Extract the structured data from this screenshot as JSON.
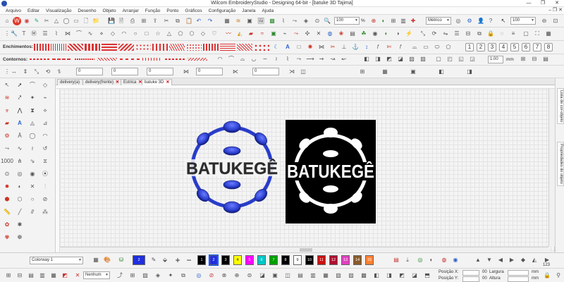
{
  "window": {
    "title": "Wilcom EmbroideryStudio - Designing 64-bit - [batuke 3D    Tajima]",
    "minimize": "—",
    "maximize": "❐",
    "close": "✕"
  },
  "menu": {
    "items": [
      "Arquivo",
      "Editar",
      "Visualização",
      "Desenho",
      "Objeto",
      "Arranjar",
      "Função",
      "Ponto",
      "Gráficos",
      "Configuração",
      "Janela",
      "Ajuda"
    ],
    "mdi_controls": "– ❐ ✕"
  },
  "toolbar": {
    "zoom_value": "100",
    "zoom_unit": "%",
    "units_value": "Métrico",
    "zoom_value_2": "100",
    "enchimentos_label": "Enchimentos:",
    "contornos_label": "Contornos:",
    "size_value": "1.00",
    "size_unit": "mm",
    "field_values": [
      "0",
      "0",
      "0",
      "0",
      "0"
    ]
  },
  "tabs": [
    {
      "label": "delivery(a)",
      "active": false
    },
    {
      "label": "delivery(frente)",
      "active": false
    },
    {
      "label": "Estrica",
      "active": false
    },
    {
      "label": "batuke 3D",
      "active": true
    }
  ],
  "side_panels": {
    "panel_1": "Lista de cor-objeto",
    "panel_2": "Propriedades do objeto"
  },
  "design": {
    "text": "BATUKEGÊ",
    "blue_color": "#2b3fcf",
    "black_color": "#000000"
  },
  "bottombar": {
    "colorway": "Colorway 1",
    "selected_color_number": "2",
    "palette": [
      {
        "num": "1",
        "color": "#000000"
      },
      {
        "num": "2",
        "color": "#1f2fe0"
      },
      {
        "num": "3",
        "color": "#000000"
      },
      {
        "num": "4",
        "color": "#ffff00"
      },
      {
        "num": "5",
        "color": "#ff00ff"
      },
      {
        "num": "6",
        "color": "#00c8c8"
      },
      {
        "num": "7",
        "color": "#00a000"
      },
      {
        "num": "8",
        "color": "#000000"
      },
      {
        "num": "9",
        "color": "#ffffff"
      },
      {
        "num": "10",
        "color": "#000000"
      },
      {
        "num": "11",
        "color": "#cc1010"
      },
      {
        "num": "12",
        "color": "#b01030"
      },
      {
        "num": "13",
        "color": "#e040c0"
      },
      {
        "num": "14",
        "color": "#8a5a2a"
      },
      {
        "num": "15",
        "color": "#ff8030"
      }
    ]
  },
  "statusbar": {
    "nenhum": "Nenhum",
    "pos_x": "Posição X:",
    "pos_x_unit": "00",
    "pos_y": "Posição Y:",
    "pos_y_unit": "00",
    "largura": "Largura",
    "largura_unit": "mm",
    "altura": "Altura",
    "altura_unit": "mm",
    "zoom_readout": "123"
  }
}
